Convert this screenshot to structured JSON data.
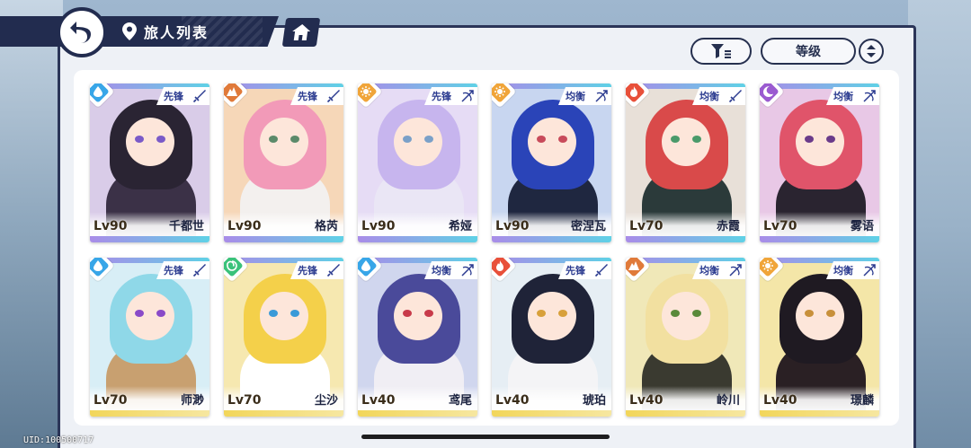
{
  "header": {
    "title": "旅人列表"
  },
  "controls": {
    "sort_label": "等级"
  },
  "uid": "UID:100500717",
  "colors": {
    "header_navy": "#222c4f",
    "role_text": "#2a3a8f",
    "strip_purple": "#a98ce8",
    "strip_cyan": "#5fd1e6",
    "strip_yellow": "#f2d65a"
  },
  "cards": [
    {
      "name": "千都世",
      "level": "Lv90",
      "role": "先锋",
      "element": "water-icon",
      "weapon": "sword-icon",
      "hair": "#2a2433",
      "body": "#3b3147",
      "eye": "#7a5ac8",
      "bg": "#d9cce8",
      "elem_color": "#38a6e8"
    },
    {
      "name": "格芮",
      "level": "Lv90",
      "role": "先锋",
      "element": "rock-icon",
      "weapon": "sword-icon",
      "hair": "#f29ab8",
      "body": "#f3f0ee",
      "eye": "#5b8a6a",
      "bg": "#f6d7b8",
      "elem_color": "#e07a3a"
    },
    {
      "name": "希娅",
      "level": "Lv90",
      "role": "先锋",
      "element": "light-icon",
      "weapon": "bow-icon",
      "hair": "#c7b5ee",
      "body": "#eae6f5",
      "eye": "#7aa0c8",
      "bg": "#e6dcf5",
      "elem_color": "#f0a53a"
    },
    {
      "name": "密涅瓦",
      "level": "Lv90",
      "role": "均衡",
      "element": "light-icon",
      "weapon": "bow-icon",
      "hair": "#2a44b8",
      "body": "#1f2740",
      "eye": "#c84a5a",
      "bg": "#c8d6f0",
      "elem_color": "#f0a53a"
    },
    {
      "name": "赤霞",
      "level": "Lv70",
      "role": "均衡",
      "element": "fire-icon",
      "weapon": "sword-icon",
      "hair": "#d94a4a",
      "body": "#2b3a3a",
      "eye": "#4a9a6a",
      "bg": "#e8e0d8",
      "elem_color": "#e8503a"
    },
    {
      "name": "雾语",
      "level": "Lv70",
      "role": "均衡",
      "element": "moon-icon",
      "weapon": "bow-icon",
      "hair": "#e0546a",
      "body": "#2a2430",
      "eye": "#6a3a8a",
      "bg": "#e8c8e6",
      "elem_color": "#9a5ad0"
    },
    {
      "name": "师渺",
      "level": "Lv70",
      "role": "先锋",
      "element": "water-icon",
      "weapon": "sword-icon",
      "hair": "#8fd8e8",
      "body": "#c8a070",
      "eye": "#8a4ac8",
      "bg": "#d8eef6",
      "elem_color": "#38a6e8"
    },
    {
      "name": "尘沙",
      "level": "Lv70",
      "role": "先锋",
      "element": "wind-icon",
      "weapon": "sword-icon",
      "hair": "#f4d04a",
      "body": "#ffffff",
      "eye": "#3a9ad8",
      "bg": "#f6e8b0",
      "elem_color": "#3ac27a"
    },
    {
      "name": "鸢尾",
      "level": "Lv40",
      "role": "均衡",
      "element": "water-icon",
      "weapon": "bow-icon",
      "hair": "#4a4a9a",
      "body": "#f0eef4",
      "eye": "#c83a4a",
      "bg": "#d0d6ee",
      "elem_color": "#38a6e8"
    },
    {
      "name": "琥珀",
      "level": "Lv40",
      "role": "先锋",
      "element": "fire-icon",
      "weapon": "sword-icon",
      "hair": "#1f2338",
      "body": "#f4f4f6",
      "eye": "#d8a03a",
      "bg": "#e6eef4",
      "elem_color": "#e8503a"
    },
    {
      "name": "岭川",
      "level": "Lv40",
      "role": "均衡",
      "element": "rock-icon",
      "weapon": "bow-icon",
      "hair": "#f2e0a0",
      "body": "#3a3a30",
      "eye": "#5a8a3a",
      "bg": "#f0e8b8",
      "elem_color": "#e07a3a"
    },
    {
      "name": "璟麟",
      "level": "Lv40",
      "role": "均衡",
      "element": "light-icon",
      "weapon": "bow-icon",
      "hair": "#1f1a22",
      "body": "#2a2024",
      "eye": "#c8903a",
      "bg": "#f4e6a8",
      "elem_color": "#f0a53a"
    }
  ]
}
